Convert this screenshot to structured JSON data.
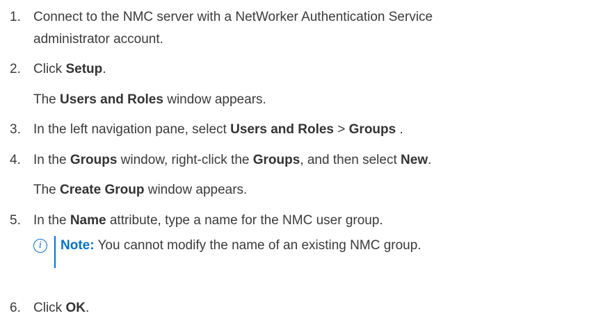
{
  "steps": [
    {
      "num": "1.",
      "line1": "Connect to the NMC server with a NetWorker Authentication Service",
      "line2": "administrator account."
    },
    {
      "num": "2.",
      "pre": "Click ",
      "b1": "Setup",
      "post": ".",
      "result": {
        "pre": "The ",
        "b": "Users and Roles",
        "post": " window appears."
      }
    },
    {
      "num": "3.",
      "pre": "In the left navigation pane, select ",
      "b1": "Users and Roles",
      "mid": " > ",
      "b2": "Groups",
      "post": " ."
    },
    {
      "num": "4.",
      "pre": "In the ",
      "b1": "Groups",
      "mid1": " window, right-click the ",
      "b2": "Groups",
      "mid2": ", and then select ",
      "b3": "New",
      "post": ".",
      "result": {
        "pre": "The ",
        "b": "Create Group",
        "post": " window appears."
      }
    },
    {
      "num": "5.",
      "pre": "In the ",
      "b1": "Name",
      "post": " attribute, type a name for the NMC user group.",
      "note": {
        "icon": "i",
        "label": "Note:",
        "text": " You cannot modify the name of an existing NMC group."
      }
    },
    {
      "num": "6.",
      "pre": "Click ",
      "b1": "OK",
      "post": "."
    }
  ]
}
